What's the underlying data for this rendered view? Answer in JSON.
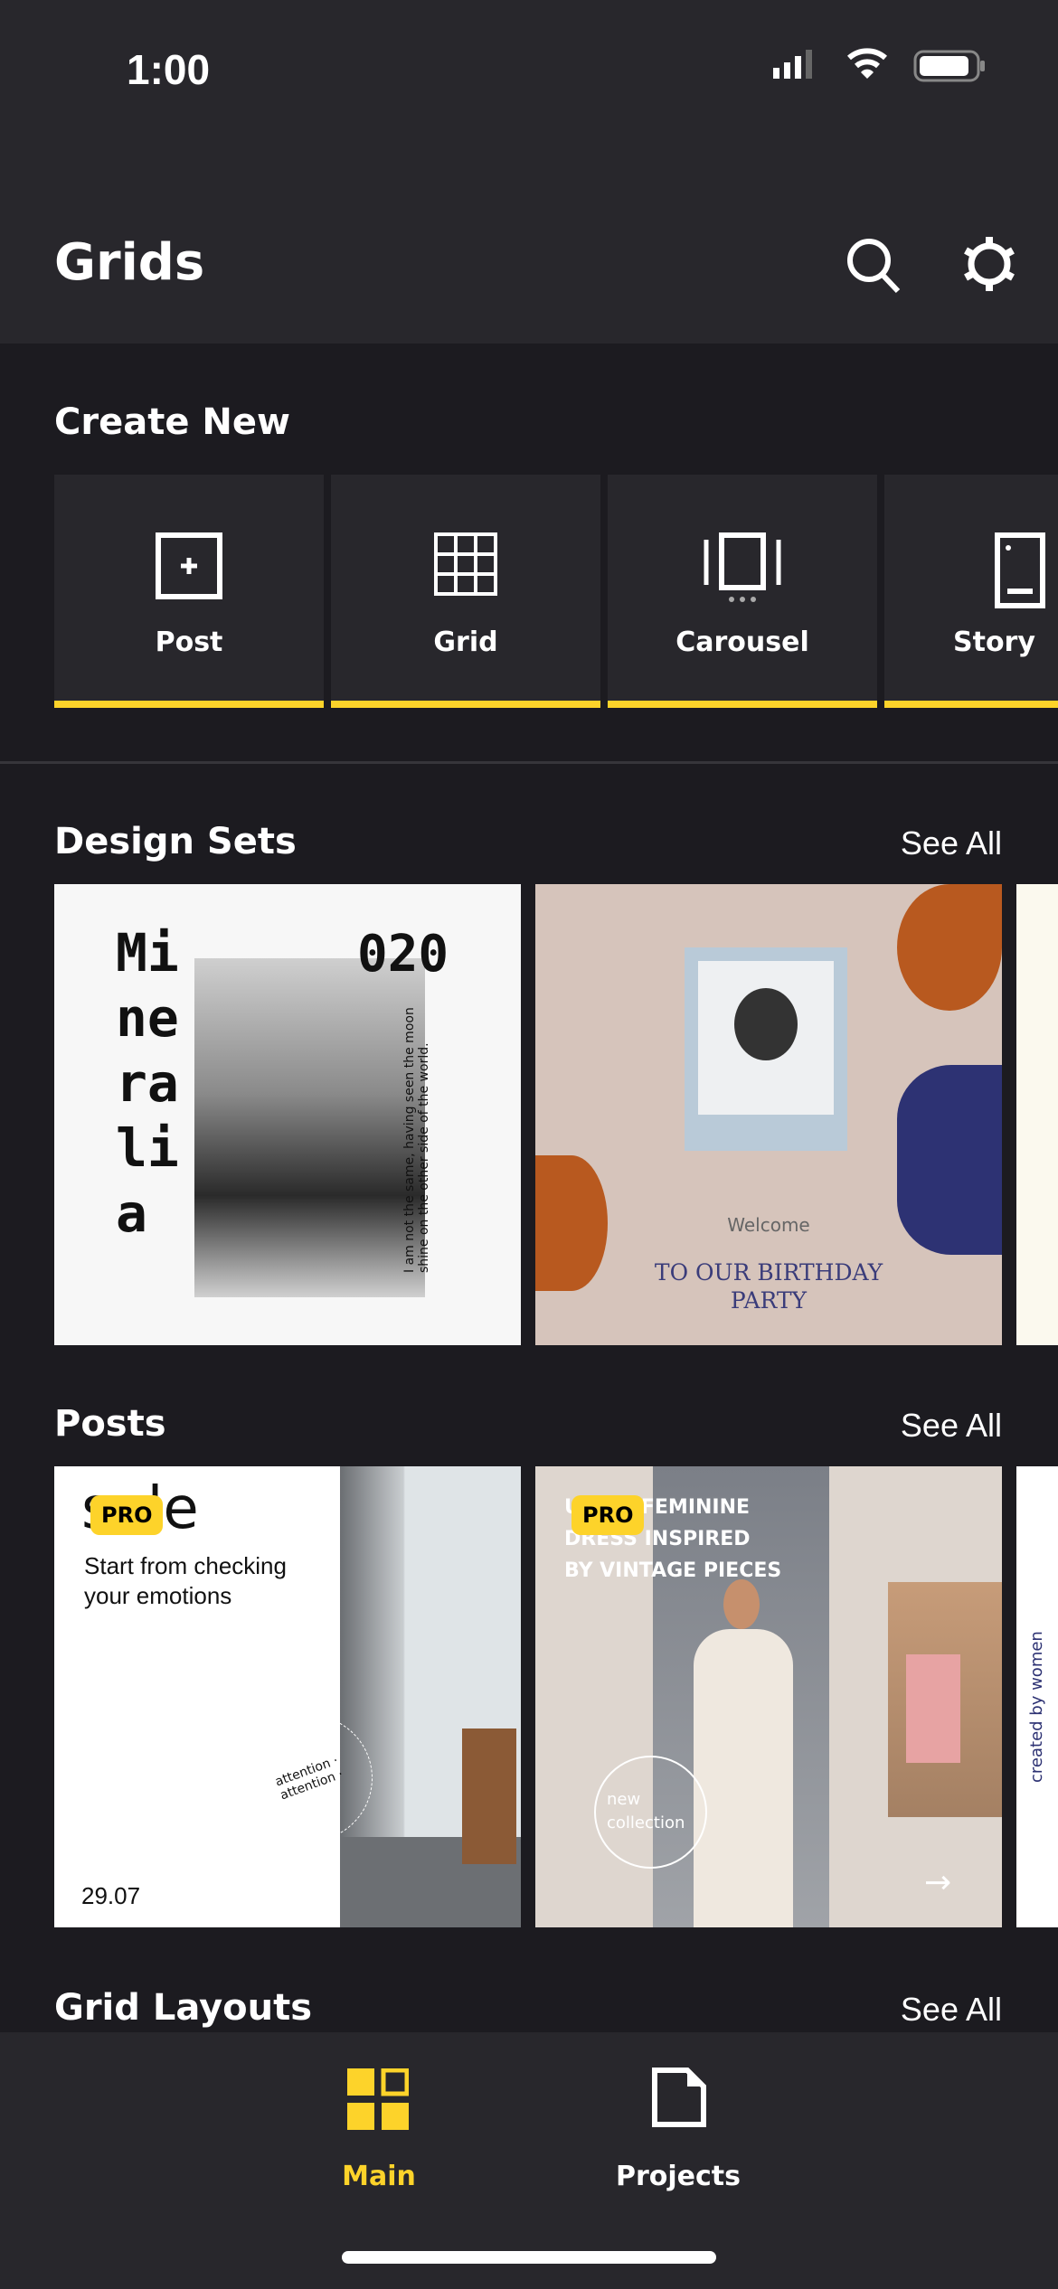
{
  "status_bar": {
    "time": "1:00"
  },
  "header": {
    "title": "Grids"
  },
  "create_new": {
    "title": "Create New",
    "items": [
      {
        "label": "Post",
        "icon": "post-add-icon"
      },
      {
        "label": "Grid",
        "icon": "grid-icon"
      },
      {
        "label": "Carousel",
        "icon": "carousel-icon"
      },
      {
        "label": "Story",
        "icon": "story-icon"
      }
    ]
  },
  "design_sets": {
    "title": "Design Sets",
    "see_all": "See All",
    "cards": [
      {
        "headline": "Mi ne ra li a",
        "number": "020",
        "caption": "I am not the same, having seen the moon shine on the other side of the world."
      },
      {
        "welcome": "Welcome",
        "line1": "TO OUR BIRTHDAY",
        "line2": "PARTY"
      }
    ]
  },
  "posts": {
    "title": "Posts",
    "see_all": "See All",
    "badge": "PRO",
    "cards": [
      {
        "headline": "sale",
        "text1": "Start from checking",
        "text2": "your emotions",
        "ring": "attention · attention ·",
        "date": "29.07"
      },
      {
        "line1": "ULTRA FEMININE",
        "line2": "DRESS INSPIRED",
        "line3": "BY VINTAGE PIECES",
        "circle": "new collection"
      },
      {
        "side": "created by women"
      }
    ]
  },
  "grid_layouts": {
    "title": "Grid Layouts",
    "see_all": "See All"
  },
  "tab_bar": {
    "items": [
      {
        "label": "Main",
        "active": true
      },
      {
        "label": "Projects",
        "active": false
      }
    ]
  },
  "colors": {
    "accent": "#fdd32a",
    "background": "#1c1b20",
    "surface": "#28272c"
  }
}
